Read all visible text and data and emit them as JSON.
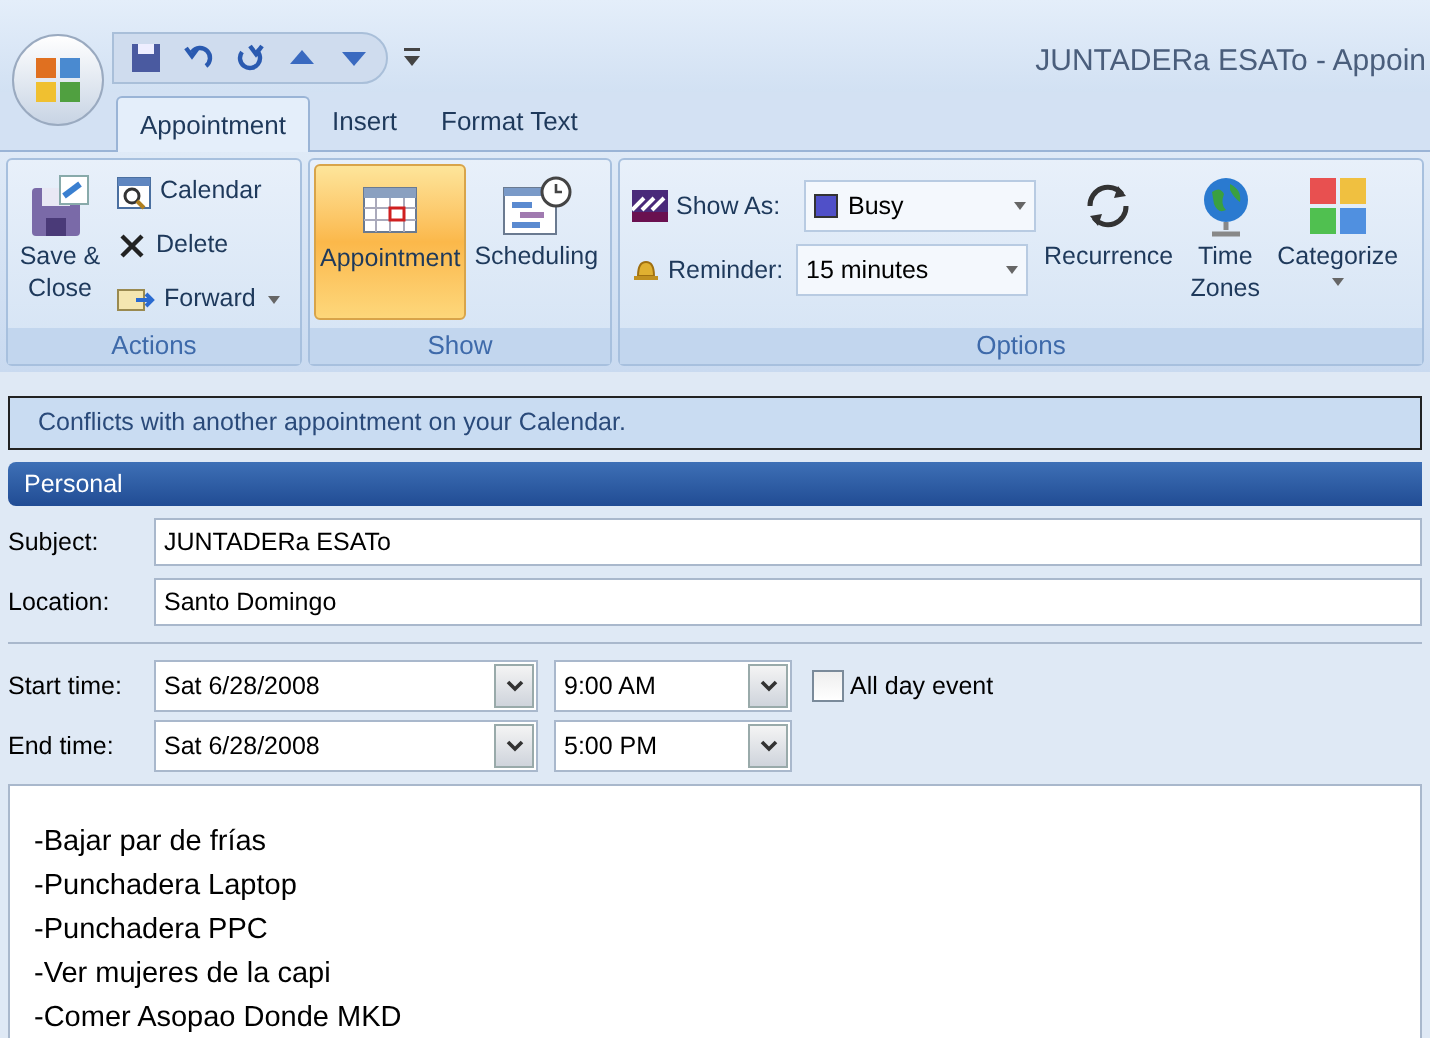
{
  "window": {
    "title": "JUNTADERa ESATo - Appoin"
  },
  "tabs": [
    {
      "label": "Appointment",
      "selected": true
    },
    {
      "label": "Insert",
      "selected": false
    },
    {
      "label": "Format Text",
      "selected": false
    }
  ],
  "ribbon": {
    "groups": [
      {
        "label": "Actions",
        "buttons": [
          {
            "kind": "large",
            "label": "Save & Close"
          },
          {
            "kind": "small",
            "label": "Calendar"
          },
          {
            "kind": "small",
            "label": "Delete"
          },
          {
            "kind": "small",
            "label": "Forward",
            "dropdown": true
          }
        ]
      },
      {
        "label": "Show",
        "buttons": [
          {
            "kind": "large",
            "label": "Appointment",
            "selected": true
          },
          {
            "kind": "large",
            "label": "Scheduling",
            "selected": false
          }
        ]
      },
      {
        "label": "Options",
        "buttons": [
          {
            "kind": "combo",
            "label": "Show As:",
            "value": "Busy",
            "color": "#5050c8"
          },
          {
            "kind": "combo",
            "label": "Reminder:",
            "value": "15 minutes"
          },
          {
            "kind": "large",
            "label": "Recurrence"
          },
          {
            "kind": "large",
            "label": "Time Zones"
          },
          {
            "kind": "large",
            "label": "Categorize",
            "dropdown": true
          }
        ]
      }
    ]
  },
  "info_bar": "Conflicts with another appointment on your Calendar.",
  "section_header": "Personal",
  "subject": {
    "label": "Subject:",
    "value": "JUNTADERa ESATo"
  },
  "location": {
    "label": "Location:",
    "value": "Santo Domingo"
  },
  "start": {
    "label": "Start time:",
    "date": "Sat 6/28/2008",
    "time": "9:00 AM"
  },
  "end": {
    "label": "End time:",
    "date": "Sat 6/28/2008",
    "time": "5:00 PM"
  },
  "all_day": {
    "label": "All day event",
    "checked": false
  },
  "body": [
    "-Bajar par de frías",
    "-Punchadera Laptop",
    "-Punchadera PPC",
    "-Ver mujeres de la capi",
    "-Comer Asopao Donde MKD"
  ]
}
